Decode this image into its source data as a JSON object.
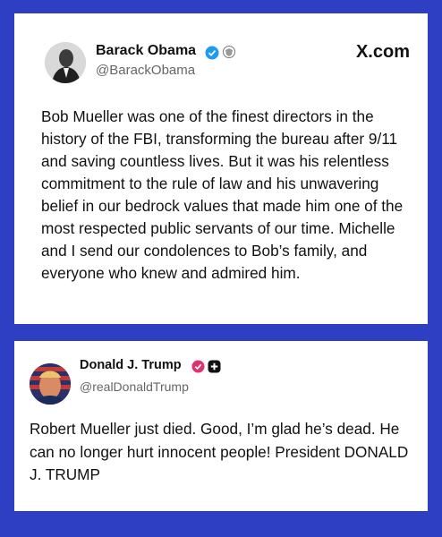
{
  "posts": [
    {
      "author": "Barack Obama",
      "handle": "@BarackObama",
      "source": "X.com",
      "text": "Bob Mueller was one of the finest directors in the history of the FBI, transforming the bureau after 9/11 and saving countless lives. But it was his relentless commitment to the rule of law and his unwavering belief in our bedrock values that made him one of the most respected public servants of our time. Michelle and I send our condolences to Bob’s family, and everyone who knew and admired him."
    },
    {
      "author": "Donald J. Trump",
      "handle": "@realDonaldTrump",
      "text": "Robert Mueller just died. Good, I’m glad he’s dead. He can no longer hurt innocent people! President DONALD J. TRUMP"
    }
  ],
  "colors": {
    "background": "#2e3fc4",
    "verified_blue": "#1d9bf0",
    "verified_pink": "#e0326e"
  },
  "icons": [
    "verified-badge-icon",
    "government-seal-icon",
    "x-logo-icon",
    "plus-badge-icon"
  ]
}
